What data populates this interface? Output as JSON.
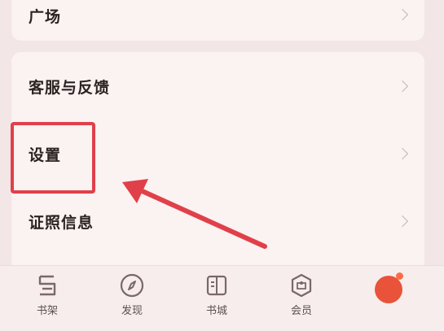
{
  "top_item": {
    "label": "广场"
  },
  "menu": {
    "items": [
      {
        "label": "客服与反馈"
      },
      {
        "label": "设置"
      },
      {
        "label": "证照信息"
      }
    ]
  },
  "tabbar": {
    "tabs": [
      {
        "label": "书架",
        "icon": "bookshelf-icon"
      },
      {
        "label": "发现",
        "icon": "compass-icon"
      },
      {
        "label": "书城",
        "icon": "book-icon"
      },
      {
        "label": "会员",
        "icon": "vip-icon"
      },
      {
        "label": "",
        "icon": "avatar"
      }
    ]
  },
  "colors": {
    "annotation": "#e0404a",
    "background": "#f3e6e6",
    "card": "#fbf2f2"
  }
}
